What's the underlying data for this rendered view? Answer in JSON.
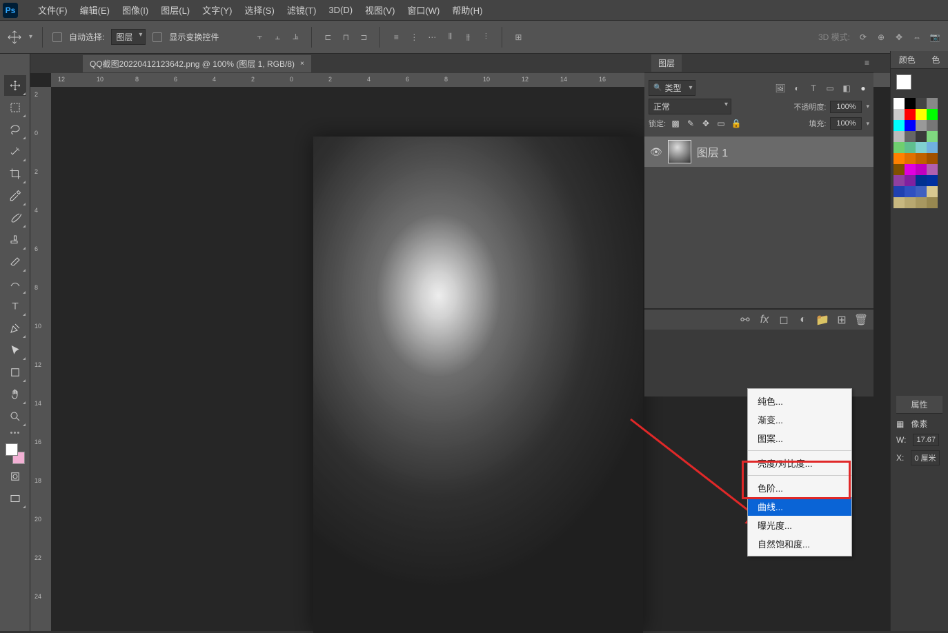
{
  "menubar": {
    "items": [
      "文件(F)",
      "编辑(E)",
      "图像(I)",
      "图层(L)",
      "文字(Y)",
      "选择(S)",
      "滤镜(T)",
      "3D(D)",
      "视图(V)",
      "窗口(W)",
      "帮助(H)"
    ]
  },
  "options": {
    "auto_select": "自动选择:",
    "target": "图层",
    "show_transform": "显示变换控件",
    "mode3d": "3D 模式:"
  },
  "document": {
    "tab_title": "QQ截图20220412123642.png @ 100% (图层 1, RGB/8)",
    "close": "×"
  },
  "ruler": {
    "h": [
      "12",
      "10",
      "8",
      "6",
      "4",
      "2",
      "0",
      "2",
      "4",
      "6",
      "8",
      "10",
      "12",
      "14",
      "16"
    ],
    "v": [
      "2",
      "0",
      "2",
      "4",
      "6",
      "8",
      "10",
      "12",
      "14",
      "16",
      "18",
      "20",
      "22",
      "24"
    ]
  },
  "layers_panel": {
    "title": "图层",
    "type_label": "类型",
    "blend": "正常",
    "opacity_label": "不透明度:",
    "opacity_value": "100%",
    "lock_label": "锁定:",
    "fill_label": "填充:",
    "fill_value": "100%",
    "layer_name": "图层 1"
  },
  "ctx": {
    "items": [
      "纯色...",
      "渐变...",
      "图案...",
      "亮度/对比度...",
      "色阶...",
      "曲线...",
      "曝光度...",
      "自然饱和度..."
    ],
    "highlighted": 5,
    "sep_after": [
      2,
      3
    ]
  },
  "far_right": {
    "color_tab": "颜色",
    "se_tab": "色",
    "props_tab": "属性",
    "pixel": "像素",
    "w_label": "W:",
    "w_val": "17.67",
    "x_label": "X:",
    "x_val": "0 厘米"
  },
  "swatch_colors": [
    "#ffffff",
    "#000000",
    "#444444",
    "#888888",
    "#cccccc",
    "#ff0000",
    "#ffff00",
    "#00ff00",
    "#00ffff",
    "#0000ff",
    "#999999",
    "#777777",
    "#bbbbbb",
    "#666666",
    "#3a3a3a",
    "#7fd87f",
    "#6fcf6f",
    "#5fbf8f",
    "#80d0d0",
    "#70b0e0",
    "#ff8000",
    "#e07000",
    "#c06000",
    "#a05000",
    "#805000",
    "#e000e0",
    "#c000c0",
    "#b060b0",
    "#9040a0",
    "#8020a0",
    "#003090",
    "#0030a0",
    "#2040b0",
    "#3050c0",
    "#4060c0",
    "#d8c890",
    "#c8b880",
    "#b8a870",
    "#a89860",
    "#988850"
  ]
}
